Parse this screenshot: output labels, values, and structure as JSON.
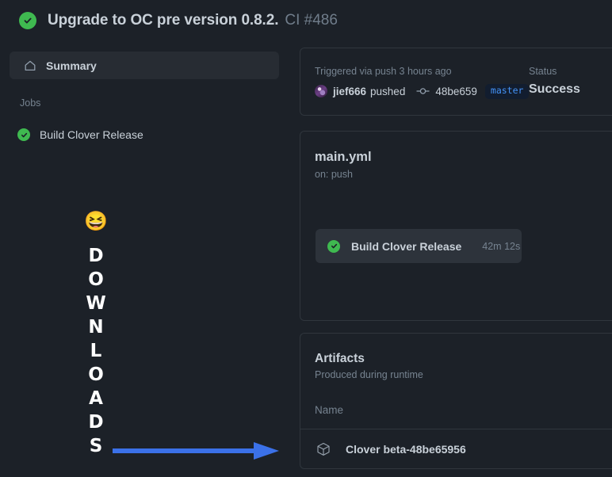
{
  "header": {
    "status_icon": "check-circle-icon",
    "title": "Upgrade to OC pre version 0.8.2.",
    "run_number": "CI #486"
  },
  "sidebar": {
    "summary": {
      "icon": "home-icon",
      "label": "Summary"
    },
    "section_title": "Jobs",
    "jobs": [
      {
        "icon": "check-circle-icon",
        "label": "Build Clover Release"
      }
    ]
  },
  "annotation": {
    "emoji": "😆",
    "word": "DOWNLOADS",
    "arrow_color": "#3b71e8"
  },
  "trigger_card": {
    "triggered_text": "Triggered via push 3 hours ago",
    "avatar": "user-avatar",
    "actor": "jief666",
    "verb": "pushed",
    "commit_icon": "commit-icon",
    "commit_sha": "48be659",
    "branch": "master",
    "branch_color": "#4493f8",
    "status_label": "Status",
    "status_value": "Success"
  },
  "workflow_card": {
    "file_name": "main.yml",
    "trigger": "on: push",
    "job": {
      "icon": "check-circle-icon",
      "name": "Build Clover Release",
      "duration": "42m 12s"
    }
  },
  "artifacts_card": {
    "title": "Artifacts",
    "subtitle": "Produced during runtime",
    "column_header": "Name",
    "rows": [
      {
        "icon": "cube-icon",
        "name": "Clover beta-48be65956"
      }
    ]
  },
  "theme": {
    "background": "#1c2128",
    "border": "#30363d",
    "text_primary": "#c9d1d9",
    "text_muted": "#768390",
    "success": "#3fb950"
  }
}
